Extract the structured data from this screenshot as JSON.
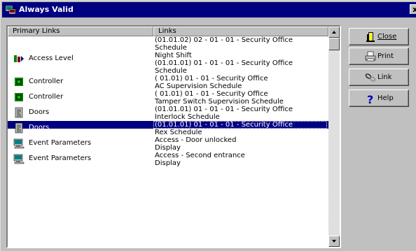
{
  "window": {
    "title": "Always Valid",
    "close_glyph": "x"
  },
  "table": {
    "columns": [
      "Primary Links",
      "Links"
    ],
    "rows": [
      {
        "primary": "",
        "icon": "",
        "links": "(01.01.02) 02 - 01 - 01 - Security Office",
        "selected": false
      },
      {
        "primary": "",
        "icon": "",
        "links": "Schedule",
        "selected": false
      },
      {
        "primary": "Access Level",
        "icon": "access-level-icon",
        "links": "Night Shift",
        "selected": false
      },
      {
        "primary": "",
        "icon": "",
        "links": "(01.01.01) 01 - 01 - 01 - Security Office",
        "selected": false
      },
      {
        "primary": "",
        "icon": "",
        "links": "Schedule",
        "selected": false
      },
      {
        "primary": "Controller",
        "icon": "controller-icon",
        "links": "( 01.01) 01 - 01 - Security Office",
        "selected": false
      },
      {
        "primary": "",
        "icon": "",
        "links": "AC Supervision Schedule",
        "selected": false
      },
      {
        "primary": "Controller",
        "icon": "controller-icon",
        "links": "( 01.01) 01 - 01 - Security Office",
        "selected": false
      },
      {
        "primary": "",
        "icon": "",
        "links": "Tamper Switch Supervision Schedule",
        "selected": false
      },
      {
        "primary": "Doors",
        "icon": "door-icon",
        "links": "(01.01.01) 01 - 01 - 01 - Security Office",
        "selected": false
      },
      {
        "primary": "",
        "icon": "",
        "links": "Interlock Schedule",
        "selected": false
      },
      {
        "primary": "Doors",
        "icon": "door-icon",
        "links": "(01.01.01) 01 - 01 - 01 - Security Office",
        "selected": true
      },
      {
        "primary": "",
        "icon": "",
        "links": "Rex Schedule",
        "selected": false
      },
      {
        "primary": "Event Parameters",
        "icon": "event-parameters-icon",
        "links": "Access - Door unlocked",
        "selected": false
      },
      {
        "primary": "",
        "icon": "",
        "links": "Display",
        "selected": false
      },
      {
        "primary": "Event Parameters",
        "icon": "event-parameters-icon",
        "links": "Access - Second entrance",
        "selected": false
      },
      {
        "primary": "",
        "icon": "",
        "links": "Display",
        "selected": false
      }
    ]
  },
  "buttons": {
    "close": {
      "label": "Close",
      "icon": "door-exit-icon"
    },
    "print": {
      "label": "Print",
      "icon": "printer-icon"
    },
    "link": {
      "label": "Link",
      "icon": "link-chain-icon"
    },
    "help": {
      "label": "Help",
      "icon": "question-mark-icon"
    }
  }
}
